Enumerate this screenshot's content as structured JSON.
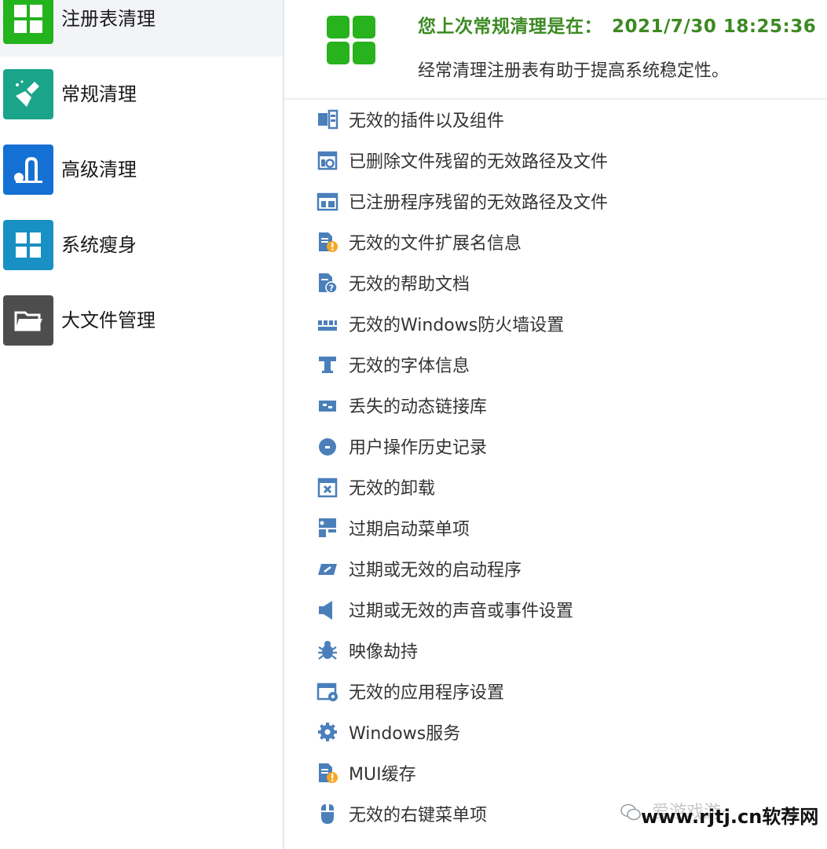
{
  "sidebar": {
    "items": [
      {
        "label": "注册表清理",
        "icon": "grid-icon",
        "color": "#22b31d",
        "active": true
      },
      {
        "label": "常规清理",
        "icon": "broom-icon",
        "color": "#1aa58a",
        "active": false
      },
      {
        "label": "高级清理",
        "icon": "vacuum-icon",
        "color": "#1470d3",
        "active": false
      },
      {
        "label": "系统瘦身",
        "icon": "windows-icon",
        "color": "#1890c4",
        "active": false
      },
      {
        "label": "大文件管理",
        "icon": "folder-icon",
        "color": "#4d4d4d",
        "active": false
      }
    ]
  },
  "header": {
    "last_clean_label": "您上次常规清理是在：",
    "last_clean_time": "2021/7/30 18:25:36",
    "tip": "经常清理注册表有助于提高系统稳定性。",
    "accent_color": "#3c8a23",
    "logo_color": "#28b21d"
  },
  "items": [
    {
      "label": "无效的插件以及组件",
      "icon": "plugin-icon"
    },
    {
      "label": "已删除文件残留的无效路径及文件",
      "icon": "deleted-file-icon"
    },
    {
      "label": "已注册程序残留的无效路径及文件",
      "icon": "program-window-icon"
    },
    {
      "label": "无效的文件扩展名信息",
      "icon": "file-warning-icon"
    },
    {
      "label": "无效的帮助文档",
      "icon": "help-doc-icon"
    },
    {
      "label": "无效的Windows防火墙设置",
      "icon": "firewall-icon"
    },
    {
      "label": "无效的字体信息",
      "icon": "font-icon"
    },
    {
      "label": "丢失的动态链接库",
      "icon": "dll-icon"
    },
    {
      "label": "用户操作历史记录",
      "icon": "history-icon"
    },
    {
      "label": "无效的卸载",
      "icon": "uninstall-icon"
    },
    {
      "label": "过期启动菜单项",
      "icon": "start-menu-icon"
    },
    {
      "label": "过期或无效的启动程序",
      "icon": "startup-program-icon"
    },
    {
      "label": "过期或无效的声音或事件设置",
      "icon": "sound-icon"
    },
    {
      "label": "映像劫持",
      "icon": "bug-icon"
    },
    {
      "label": "无效的应用程序设置",
      "icon": "app-settings-icon"
    },
    {
      "label": "Windows服务",
      "icon": "service-gear-icon"
    },
    {
      "label": "MUI缓存",
      "icon": "mui-cache-icon"
    },
    {
      "label": "无效的右键菜单项",
      "icon": "mouse-icon"
    }
  ],
  "icon_color": "#4a7fba",
  "warning_color": "#f5a623",
  "watermark": {
    "ghost": "爱游戏游·",
    "text": "www.rjtj.cn软荐网"
  }
}
